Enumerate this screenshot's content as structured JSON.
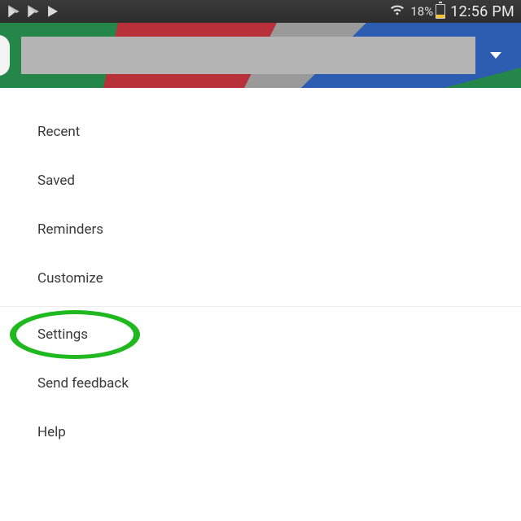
{
  "status_bar": {
    "battery_pct": "18%",
    "time": "12:56 PM"
  },
  "menu": {
    "items": [
      {
        "label": "Recent"
      },
      {
        "label": "Saved"
      },
      {
        "label": "Reminders"
      },
      {
        "label": "Customize"
      },
      {
        "label": "Settings"
      },
      {
        "label": "Send feedback"
      },
      {
        "label": "Help"
      }
    ],
    "divider_after_index": 3,
    "highlighted_index": 4
  },
  "colors": {
    "highlight": "#1fb81f",
    "header_blue": "#2c5db0",
    "header_green": "#25864a",
    "header_red": "#b7303a",
    "header_grey": "#9a9a9a",
    "battery_fill": "#f4c430"
  }
}
